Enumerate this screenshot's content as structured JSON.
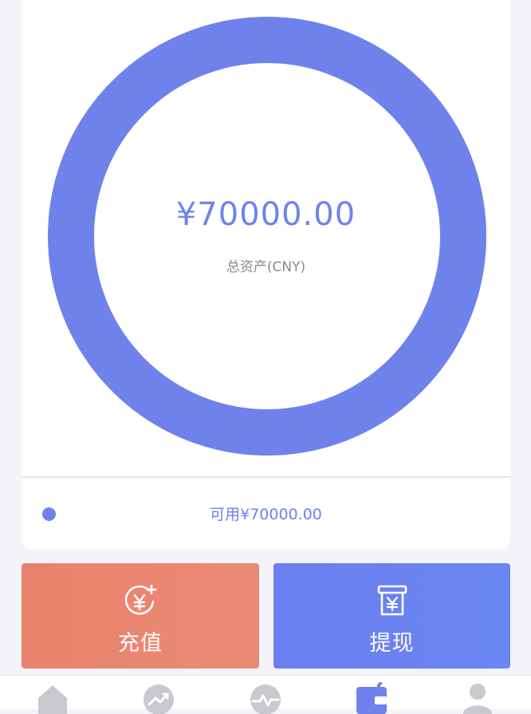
{
  "summary": {
    "total_amount": "¥70000.00",
    "total_label": "总资产(CNY)",
    "available_text": "可用¥70000.00"
  },
  "chart_data": {
    "type": "pie",
    "categories": [
      "可用"
    ],
    "values": [
      70000
    ]
  },
  "actions": {
    "recharge_label": "充值",
    "withdraw_label": "提现"
  },
  "tabbar": {
    "items": [
      {
        "icon": "home-icon"
      },
      {
        "icon": "trend-icon"
      },
      {
        "icon": "market-icon"
      },
      {
        "icon": "wallet-icon",
        "active": true
      },
      {
        "icon": "user-icon"
      }
    ]
  },
  "colors": {
    "accent": "#6f82ec",
    "recharge": "#e9826c",
    "withdraw": "#6b7ff0"
  }
}
